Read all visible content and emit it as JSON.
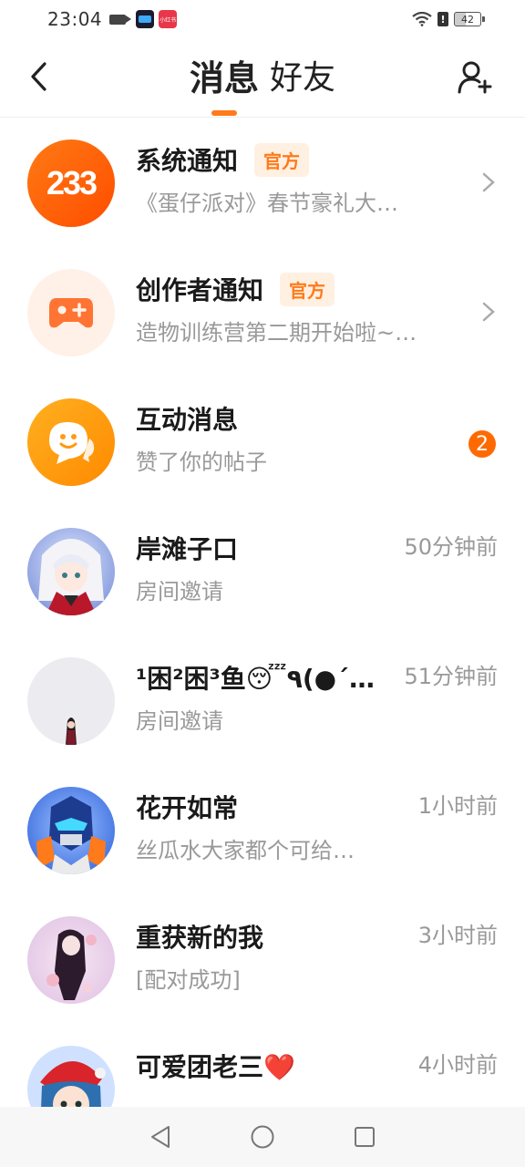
{
  "status_bar": {
    "time": "23:04",
    "app_badge_text": "小红书",
    "alert_glyph": "!",
    "battery": "42"
  },
  "header": {
    "tab_messages": "消息",
    "tab_friends": "好友",
    "back_icon": "chevron-left-icon",
    "add_friend_icon": "add-user-icon",
    "accent": "#ff7a1a"
  },
  "messages": [
    {
      "title": "系统通知",
      "badge": "官方",
      "subtitle": "《蛋仔派对》春节豪礼大…",
      "avatar_text": "233",
      "trailing": "chevron"
    },
    {
      "title": "创作者通知",
      "badge": "官方",
      "subtitle": "造物训练营第二期开始啦~…",
      "avatar_icon": "gamepad-icon",
      "trailing": "chevron"
    },
    {
      "title": "互动消息",
      "subtitle": "赞了你的帖子",
      "avatar_icon": "chat-bubble-smile-icon",
      "unread": "2"
    },
    {
      "title": "岸滩子口",
      "subtitle": "房间邀请",
      "time": "50分钟前"
    },
    {
      "title": "¹困²困³鱼😴٩(●´…",
      "subtitle": "房间邀请",
      "time": "51分钟前"
    },
    {
      "title": "花开如常",
      "subtitle": "丝瓜水大家都个可给…",
      "time": "1小时前"
    },
    {
      "title": "重获新的我",
      "subtitle": "[配对成功]",
      "time": "3小时前"
    },
    {
      "title": "可爱团老三❤️",
      "subtitle": "",
      "time": "4小时前"
    }
  ],
  "nav_bar": {
    "back": "triangle-back-icon",
    "home": "circle-home-icon",
    "recents": "square-recents-icon"
  }
}
